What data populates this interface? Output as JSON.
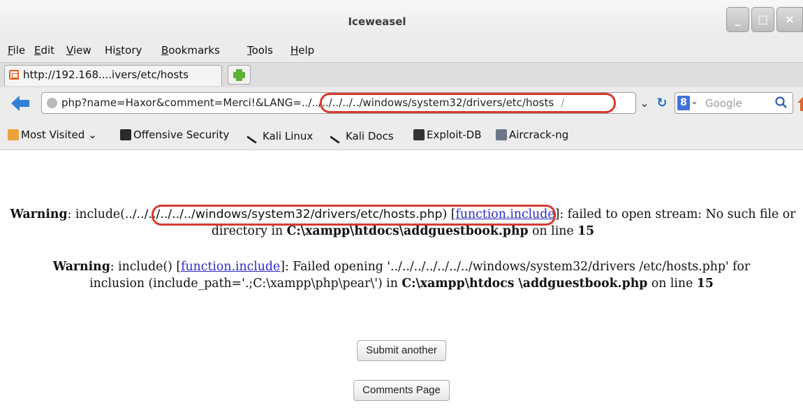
{
  "window": {
    "title": "Iceweasel"
  },
  "menu": {
    "items": [
      {
        "label": "File",
        "u": "F",
        "rest": "ile"
      },
      {
        "label": "Edit",
        "u": "E",
        "rest": "dit"
      },
      {
        "label": "View",
        "u": "V",
        "rest": "iew"
      },
      {
        "label": "History",
        "u": "s",
        "pre": "Hi",
        "rest": "tory"
      },
      {
        "label": "Bookmarks",
        "u": "B",
        "rest": "ookmarks"
      },
      {
        "label": "Tools",
        "u": "T",
        "rest": "ools"
      },
      {
        "label": "Help",
        "u": "H",
        "rest": "elp"
      }
    ]
  },
  "tab": {
    "label": "http://192.168....ivers/etc/hosts"
  },
  "urlbar": {
    "prefix": "php?name=Haxor&comment=Merci!&LANG=",
    "path": "../../../../../../windows/system32/drivers/etc/hosts",
    "overflow": "/"
  },
  "search": {
    "engine": "Google"
  },
  "bookmarks": {
    "most_visited": "Most Visited",
    "items": [
      "Offensive Security",
      "Kali Linux",
      "Kali Docs",
      "Exploit-DB",
      "Aircrack-ng"
    ]
  },
  "content": {
    "warning1": {
      "label": "Warning",
      "pre": ": include(",
      "path": "../../../../../../windows/system32/drivers/etc/hosts.php",
      "close": ") [",
      "link": "function.include",
      "mid": "]: failed to open stream: No such file or directory in ",
      "file": "C:\\xampp\\htdocs\\addguestbook.php",
      "online": " on line ",
      "line": "15"
    },
    "warning2": {
      "label": "Warning",
      "pre": ": include() [",
      "link": "function.include",
      "mid": "]: Failed opening '../../../../../../../windows/system32/drivers /etc/hosts.php' for inclusion (include_path='.;C:\\xampp\\php\\pear\\') in ",
      "file": "C:\\xampp\\htdocs \\addguestbook.php",
      "online": " on line ",
      "line": "15"
    },
    "buttons": {
      "submit_another": "Submit another",
      "comments_page": "Comments Page"
    }
  }
}
